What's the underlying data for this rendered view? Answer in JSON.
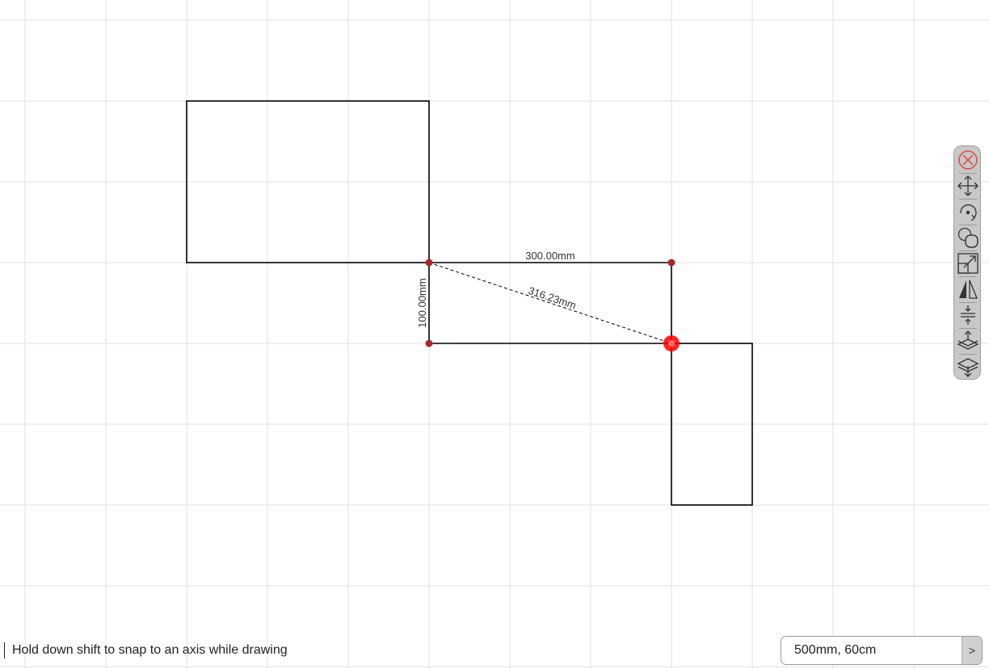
{
  "canvas": {
    "grid_color": "#e0e0e0",
    "shape_stroke": "#000000",
    "dim_line_color": "#000000",
    "point_color": "#a52a2a",
    "cursor_point_color": "#ff0000"
  },
  "dimensions": {
    "horizontal": "300.00mm",
    "vertical": "100.00mm",
    "diagonal": "316.23mm"
  },
  "toolbar": {
    "tools": [
      {
        "id": "cancel",
        "icon": "cancel-circle-icon",
        "accent": "#d9534f"
      },
      {
        "id": "move",
        "icon": "move-arrows-icon"
      },
      {
        "id": "rotate",
        "icon": "rotate-icon"
      },
      {
        "id": "copy",
        "icon": "copy-shapes-icon"
      },
      {
        "id": "scale",
        "icon": "scale-icon"
      },
      {
        "id": "mirror",
        "icon": "mirror-icon"
      },
      {
        "id": "offset",
        "icon": "offset-icon"
      },
      {
        "id": "layer-up",
        "icon": "layer-up-icon"
      },
      {
        "id": "layer-down",
        "icon": "layer-down-icon"
      }
    ]
  },
  "status": {
    "message": "Hold down shift to snap to an axis while drawing"
  },
  "coordinate_input": {
    "value": "500mm, 60cm",
    "submit_label": ">"
  }
}
